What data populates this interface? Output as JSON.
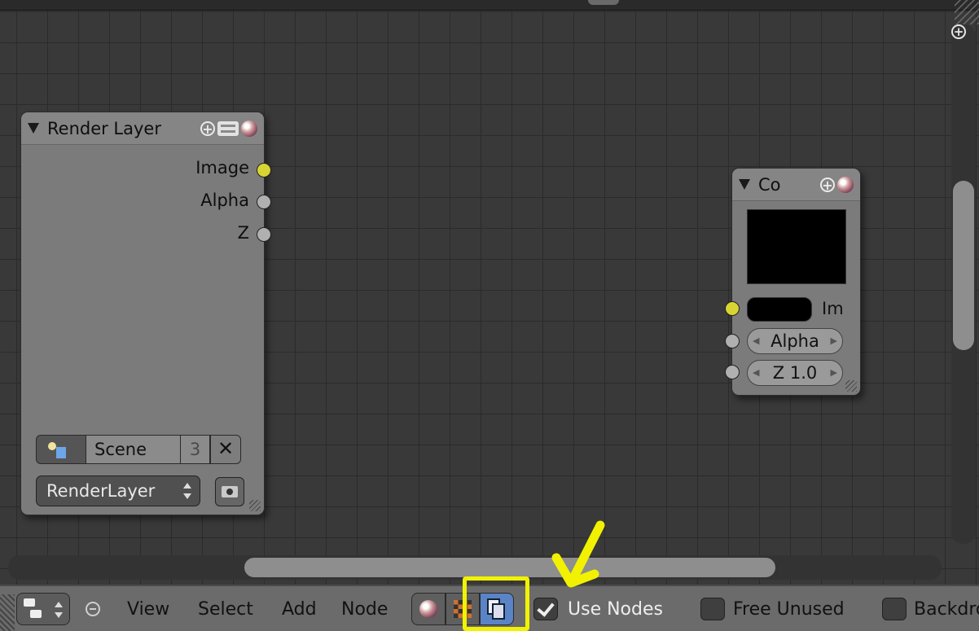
{
  "nodes": {
    "render_layer": {
      "title": "Render Layer",
      "outputs": [
        "Image",
        "Alpha",
        "Z"
      ],
      "scene_name": "Scene",
      "scene_users": "3",
      "scene_close": "✕",
      "layer_select": "RenderLayer"
    },
    "composite": {
      "title": "Co",
      "image_input_label": "Im",
      "alpha_field": "Alpha",
      "z_field": "Z 1.0"
    }
  },
  "header": {
    "menus": [
      "View",
      "Select",
      "Add",
      "Node"
    ],
    "use_nodes_label": "Use Nodes",
    "use_nodes_checked": true,
    "free_unused_label": "Free Unused",
    "free_unused_checked": false,
    "backdrop_label": "Backdrop",
    "active_node_tree_type": "compositing"
  },
  "annotation": {
    "highlight_color": "#f2f200"
  },
  "colors": {
    "socket_image": "#d8d433",
    "socket_value": "#b0b0b0",
    "active_button": "#5b84c6"
  }
}
